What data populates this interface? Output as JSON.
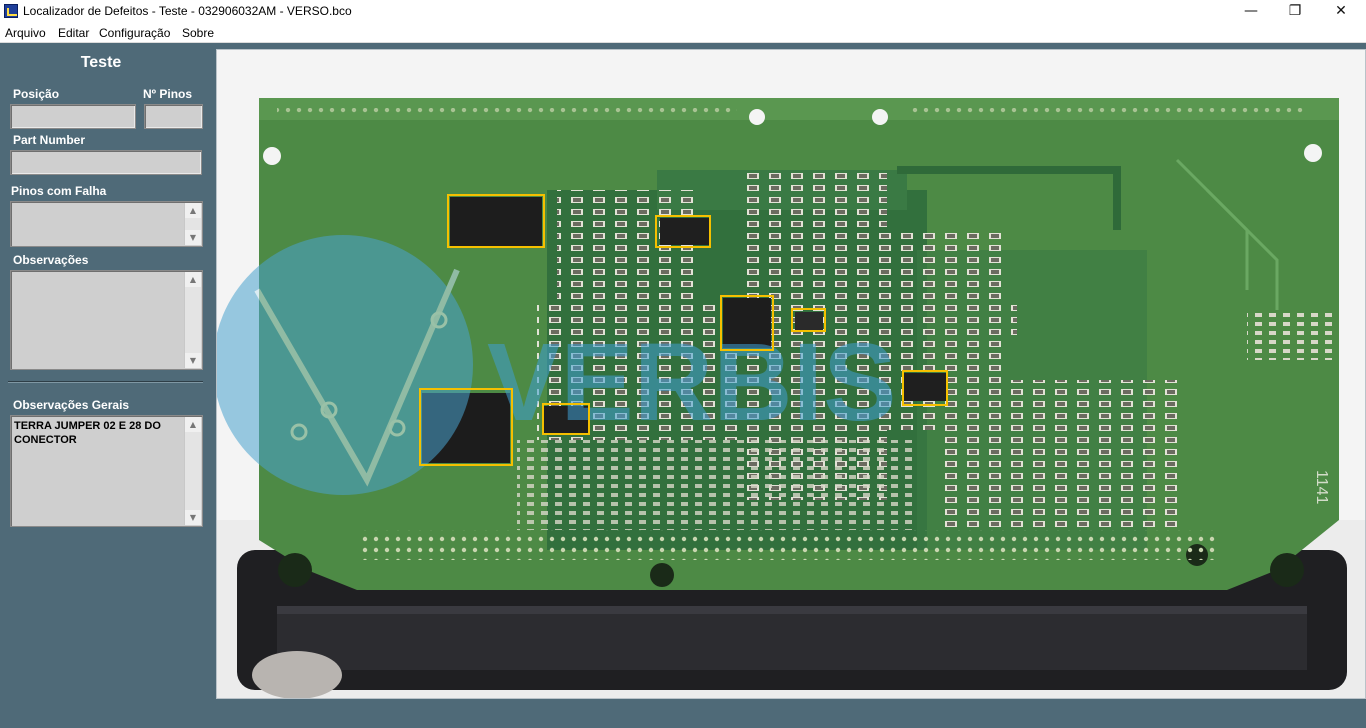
{
  "window": {
    "title": "Localizador de Defeitos - Teste - 032906032AM - VERSO.bco",
    "minimize_glyph": "—",
    "maximize_glyph": "❐",
    "close_glyph": "✕"
  },
  "menu": {
    "items": [
      "Arquivo",
      "Editar",
      "Configuração",
      "Sobre"
    ]
  },
  "panel": {
    "title": "Teste",
    "posicao_label": "Posição",
    "posicao_value": "",
    "pinos_label": "Nº Pinos",
    "pinos_value": "",
    "part_number_label": "Part Number",
    "part_number_value": "",
    "pinos_falha_label": "Pinos com Falha",
    "pinos_falha_value": "",
    "observacoes_label": "Observações",
    "observacoes_value": "",
    "observacoes_gerais_label": "Observações Gerais",
    "observacoes_gerais_value": "TERRA JUMPER 02 E 28 DO CONECTOR"
  },
  "viewer": {
    "image": "pcb-board-back-side",
    "watermark_text": "VERBIS",
    "board_silkscreen": "1141",
    "highlight_color": "#f5c000",
    "board_color": "#4d8a45"
  },
  "colors": {
    "background": "#4f6a78",
    "field": "#cfcfcf"
  }
}
